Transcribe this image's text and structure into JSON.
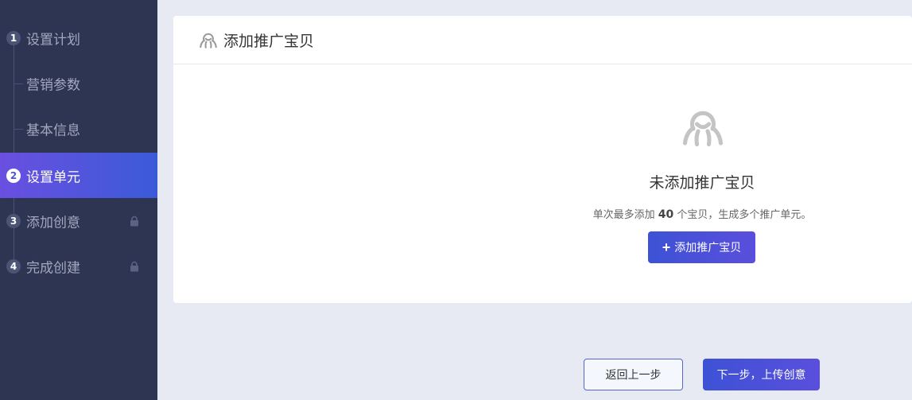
{
  "sidebar": {
    "steps": [
      {
        "num": "1",
        "label": "设置计划"
      },
      {
        "label": "营销参数"
      },
      {
        "label": "基本信息"
      },
      {
        "num": "2",
        "label": "设置单元"
      },
      {
        "num": "3",
        "label": "添加创意"
      },
      {
        "num": "4",
        "label": "完成创建"
      }
    ],
    "active_index": 3,
    "locked_indices": [
      4,
      5
    ]
  },
  "card": {
    "title": "添加推广宝贝",
    "header_icon": "octopus-icon",
    "empty_icon": "octopus-icon",
    "empty_title": "未添加推广宝贝",
    "hint_prefix": "单次最多添加 ",
    "hint_count": "40",
    "hint_suffix": " 个宝贝，生成多个推广单元。",
    "add_button_plus": "+",
    "add_button_label": "添加推广宝贝"
  },
  "footer": {
    "back_label": "返回上一步",
    "next_label": "下一步，上传创意"
  },
  "colors": {
    "sidebar_bg": "#2e3553",
    "accent": "#3d52d5",
    "accent_alt": "#6a4fe0",
    "page_bg": "#e7eaf2",
    "icon_gray": "#bdbdbd"
  }
}
